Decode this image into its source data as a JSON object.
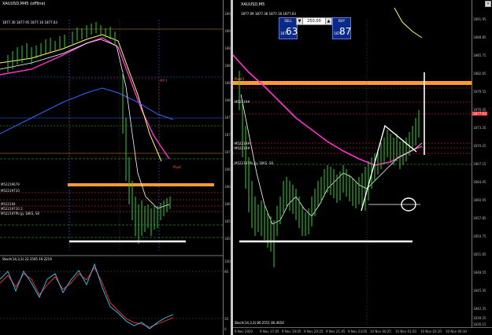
{
  "left": {
    "title": "XAUUSD,M45",
    "title_status": "(offline)",
    "ohlc": "1877.30 1877.95 1877.16 1877.63",
    "line_labels": [
      "#P 1",
      "Pivot",
      "M52219679",
      "M52219710",
      "M522194",
      "M52219710 2",
      "M522197Pb Jjy 1BKS, S8"
    ],
    "axis_values": [
      "1895",
      "1892",
      "1889",
      "1886",
      "1883",
      "1880",
      "1877",
      "1874",
      "1871",
      "1868",
      "1865",
      "1862",
      "1859",
      "1856"
    ],
    "stoch_title": "Stoch(14,3,3) 22.1505 19.2219",
    "stoch_axis": [
      "100",
      "80",
      "20",
      "0"
    ]
  },
  "right": {
    "title": "XAUUSD,M5",
    "ohlc": "1877.09 1877.36 1877.16 1877.63",
    "trade_panel": {
      "sell_label": "SELL",
      "buy_label": "BUY",
      "lot": "250.00",
      "sell_price_small": "1877",
      "sell_price_big": "63",
      "buy_price_small": "1877",
      "buy_price_big": "87"
    },
    "line_labels": [
      "Pivot1",
      "M52219#",
      "M52219#",
      "M52219#",
      "M522197Pb Jjy 1BKS, S8"
    ],
    "price_tag": "1877.63",
    "axis_values": [
      "1891.95",
      "1888.85",
      "1885.75",
      "1882.65",
      "1879.55",
      "1876.45",
      "1873.35",
      "1870.25",
      "1867.15",
      "1864.05",
      "1860.95",
      "1857.85",
      "1854.75",
      "1851.65",
      "1848.55",
      "1845.45",
      "1842.35",
      "1839.25",
      "1836.15"
    ],
    "time_labels": [
      "9 Nov 2020",
      "9 Nov 17:45",
      "9 Nov 19:05",
      "9 Nov 20:25",
      "9 Nov 21:45",
      "9 Nov 23:05",
      "10 Nov 00:25",
      "10 Nov 01:50",
      "10 Nov 03:10",
      "10 Nov 04:30"
    ],
    "stoch_title": "Stoch(14,3,3) 80.2551 80.4654"
  },
  "colors": {
    "background": "#000000",
    "candle": "#33cc33",
    "ma_magenta": "#ff33cc",
    "ma_yellow": "#ffff66",
    "ma_white": "#ffffff",
    "ma_blue": "#3366ff",
    "zone_orange": "#ff9933",
    "stoch_red": "#ff3333",
    "stoch_cyan": "#33ccff"
  }
}
